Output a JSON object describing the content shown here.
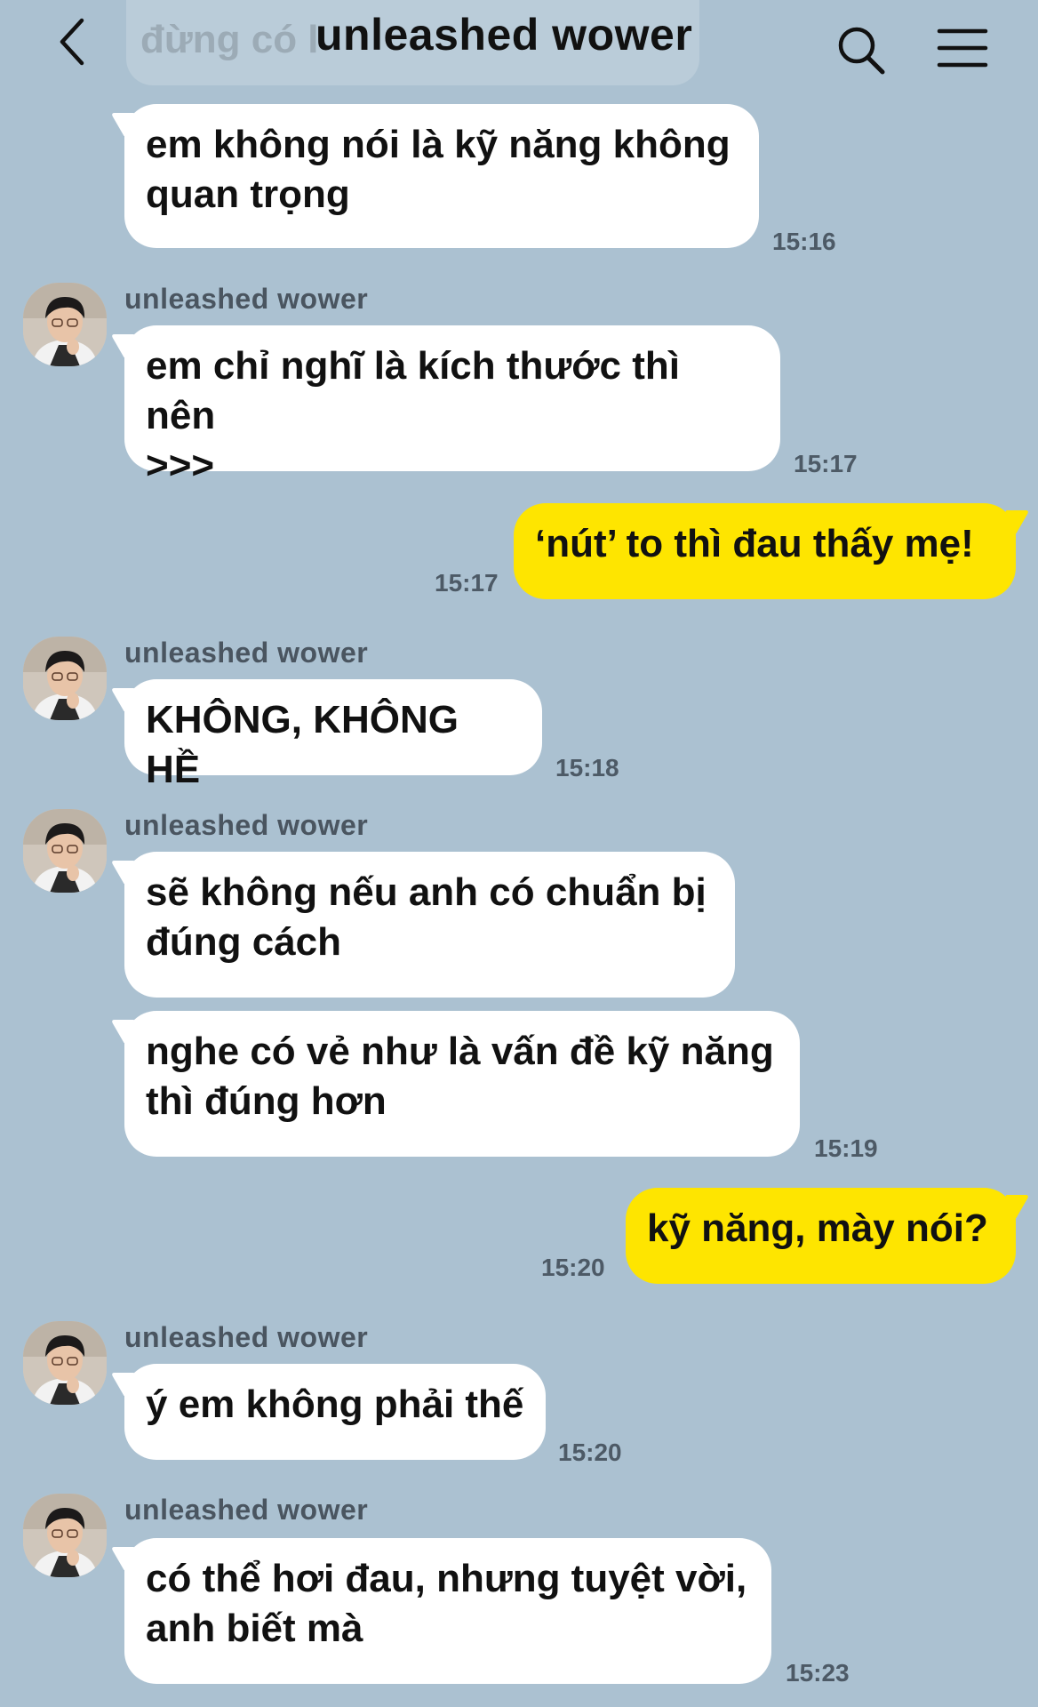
{
  "header": {
    "title": "unleashed wower",
    "faded_preview": "đừng có l",
    "back_icon": "chevron-left-icon",
    "search_icon": "search-icon",
    "menu_icon": "menu-icon"
  },
  "colors": {
    "background": "#abc1d1",
    "incoming_bubble": "#ffffff",
    "outgoing_bubble": "#fee500"
  },
  "messages": [
    {
      "from": "them",
      "show_sender": false,
      "lines": [
        "em không nói là kỹ năng không",
        "quan trọng"
      ],
      "time": "15:16"
    },
    {
      "from": "them",
      "show_sender": true,
      "sender": "unleashed wower",
      "lines": [
        "em chỉ nghĩ là kích thước thì nên",
        ">>>"
      ],
      "time": "15:17"
    },
    {
      "from": "me",
      "lines": [
        "‘nút’ to thì đau thấy mẹ!"
      ],
      "time": "15:17"
    },
    {
      "from": "them",
      "show_sender": true,
      "sender": "unleashed wower",
      "lines": [
        "KHÔNG, KHÔNG HỀ"
      ],
      "time": "15:18"
    },
    {
      "from": "them",
      "show_sender": true,
      "sender": "unleashed wower",
      "lines": [
        "sẽ không nếu anh có chuẩn bị",
        "đúng cách"
      ],
      "time": ""
    },
    {
      "from": "them",
      "show_sender": false,
      "lines": [
        "nghe có vẻ như là vấn đề kỹ năng",
        "thì đúng hơn"
      ],
      "time": "15:19"
    },
    {
      "from": "me",
      "lines": [
        "kỹ năng, mày nói?"
      ],
      "time": "15:20"
    },
    {
      "from": "them",
      "show_sender": true,
      "sender": "unleashed wower",
      "lines": [
        "ý em không phải thế"
      ],
      "time": "15:20"
    },
    {
      "from": "them",
      "show_sender": true,
      "sender": "unleashed wower",
      "lines": [
        "có thể hơi đau, nhưng tuyệt vời,",
        "anh biết mà"
      ],
      "time": "15:23"
    }
  ]
}
